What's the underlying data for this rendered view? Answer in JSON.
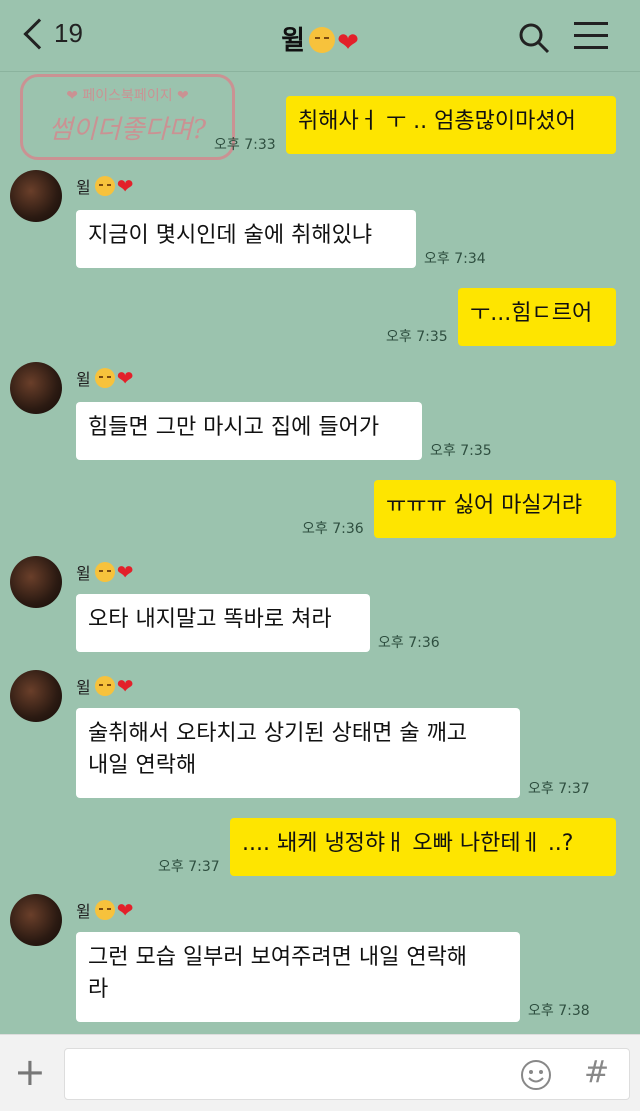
{
  "header": {
    "back_count": "19",
    "title": "윌",
    "icons": [
      "chevron-left-icon",
      "kiss-emoji-icon",
      "heart-icon",
      "search-icon",
      "menu-icon"
    ]
  },
  "watermark": {
    "line1": "❤ 페이스북페이지 ❤",
    "line2": "썸이더좋다며?"
  },
  "contact": {
    "name": "윌"
  },
  "messages": [
    {
      "from": "me",
      "text": "취해사ㅓ ㅜ .. 엄총많이마셨어",
      "time": "오후 7:33"
    },
    {
      "from": "them",
      "text": "지금이 몇시인데 술에 취해있냐",
      "time": "오후 7:34"
    },
    {
      "from": "me",
      "text": "ㅜ...힘ㄷ르어",
      "time": "오후 7:35"
    },
    {
      "from": "them",
      "text": "힘들면 그만 마시고 집에 들어가",
      "time": "오후 7:35"
    },
    {
      "from": "me",
      "text": "ㅠㅠㅠ 싫어 마실거랴",
      "time": "오후 7:36"
    },
    {
      "from": "them",
      "text": "오타 내지말고 똑바로 쳐라",
      "time": "오후 7:36"
    },
    {
      "from": "them",
      "text": "술취해서 오타치고 상기된 상태면 술 깨고\n내일 연락해",
      "time": "오후 7:37"
    },
    {
      "from": "me",
      "text": ".... 놰케 냉정햐ㅐ 오빠 나한테ㅔ ..?",
      "time": "오후 7:37"
    },
    {
      "from": "them",
      "text": "그런 모습 일부러 보여주려면 내일 연락해\n라",
      "time": "오후 7:38"
    }
  ],
  "input": {
    "placeholder": "",
    "icons": [
      "plus-icon",
      "emoji-icon",
      "hash-icon"
    ],
    "hash_glyph": "#"
  },
  "colors": {
    "background": "#9bc3ae",
    "my_bubble": "#fee500",
    "their_bubble": "#ffffff"
  }
}
